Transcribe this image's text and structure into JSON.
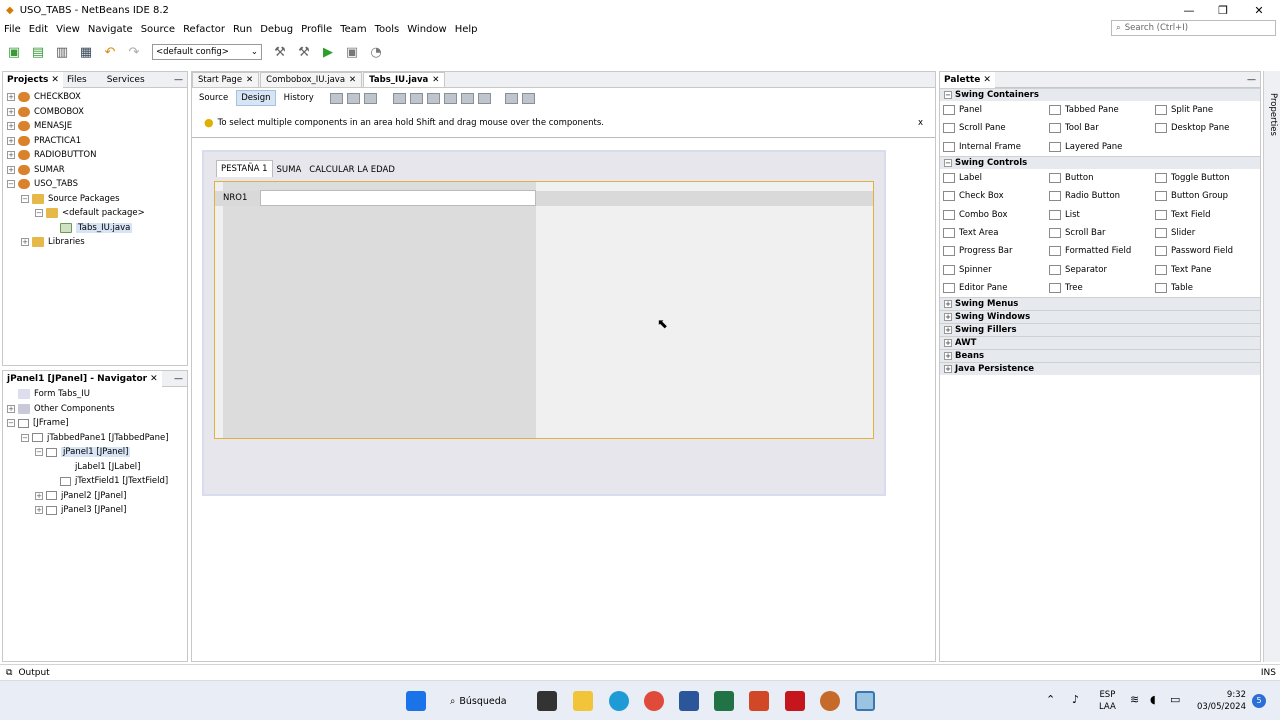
{
  "window": {
    "title": "USO_TABS - NetBeans IDE 8.2",
    "controls": [
      "—",
      "❐",
      "✕"
    ]
  },
  "menu": [
    "File",
    "Edit",
    "View",
    "Navigate",
    "Source",
    "Refactor",
    "Run",
    "Debug",
    "Profile",
    "Team",
    "Tools",
    "Window",
    "Help"
  ],
  "search": {
    "placeholder": "Search (Ctrl+I)"
  },
  "toolbar": {
    "config": "<default config>"
  },
  "projects": {
    "tabs": [
      "Projects",
      "Files",
      "Services"
    ],
    "tree": [
      {
        "label": "CHECKBOX",
        "indent": 0,
        "exp": "+",
        "type": "proj"
      },
      {
        "label": "COMBOBOX",
        "indent": 0,
        "exp": "+",
        "type": "proj"
      },
      {
        "label": "MENASJE",
        "indent": 0,
        "exp": "+",
        "type": "proj"
      },
      {
        "label": "PRACTICA1",
        "indent": 0,
        "exp": "+",
        "type": "proj"
      },
      {
        "label": "RADIOBUTTON",
        "indent": 0,
        "exp": "+",
        "type": "proj"
      },
      {
        "label": "SUMAR",
        "indent": 0,
        "exp": "+",
        "type": "proj"
      },
      {
        "label": "USO_TABS",
        "indent": 0,
        "exp": "−",
        "type": "proj"
      },
      {
        "label": "Source Packages",
        "indent": 1,
        "exp": "−",
        "type": "folder"
      },
      {
        "label": "<default package>",
        "indent": 2,
        "exp": "−",
        "type": "pkg"
      },
      {
        "label": "Tabs_IU.java",
        "indent": 3,
        "exp": "",
        "type": "file",
        "sel": true
      },
      {
        "label": "Libraries",
        "indent": 1,
        "exp": "+",
        "type": "folder"
      }
    ]
  },
  "navigator": {
    "title": "jPanel1 [JPanel] - Navigator",
    "tree": [
      {
        "label": "Form Tabs_IU",
        "indent": 0,
        "exp": "",
        "type": "form"
      },
      {
        "label": "Other Components",
        "indent": 0,
        "exp": "+",
        "type": "comp"
      },
      {
        "label": "[JFrame]",
        "indent": 0,
        "exp": "−",
        "type": "box"
      },
      {
        "label": "jTabbedPane1 [JTabbedPane]",
        "indent": 1,
        "exp": "−",
        "type": "box"
      },
      {
        "label": "jPanel1 [JPanel]",
        "indent": 2,
        "exp": "−",
        "type": "box",
        "sel": true
      },
      {
        "label": "jLabel1 [JLabel]",
        "indent": 3,
        "exp": "",
        "type": "label"
      },
      {
        "label": "jTextField1 [JTextField]",
        "indent": 3,
        "exp": "",
        "type": "box"
      },
      {
        "label": "jPanel2 [JPanel]",
        "indent": 2,
        "exp": "+",
        "type": "box"
      },
      {
        "label": "jPanel3 [JPanel]",
        "indent": 2,
        "exp": "+",
        "type": "box"
      }
    ]
  },
  "editor": {
    "tabs": [
      {
        "label": "Start Page",
        "active": false
      },
      {
        "label": "Combobox_IU.java",
        "active": false
      },
      {
        "label": "Tabs_IU.java",
        "active": true
      }
    ],
    "modes": [
      "Source",
      "Design",
      "History"
    ],
    "hint": "To select multiple components in an area hold Shift and drag mouse over the components.",
    "hint_close": "x",
    "form_tabs": [
      "PESTAÑA 1",
      "SUMA",
      "CALCULAR LA EDAD"
    ],
    "label_nro1": "NRO1"
  },
  "palette": {
    "title": "Palette",
    "sections": [
      {
        "name": "Swing Containers",
        "items": [
          "Panel",
          "Tabbed Pane",
          "Split Pane",
          "Scroll Pane",
          "Tool Bar",
          "Desktop Pane",
          "Internal Frame",
          "Layered Pane"
        ]
      },
      {
        "name": "Swing Controls",
        "items": [
          "Label",
          "Button",
          "Toggle Button",
          "Check Box",
          "Radio Button",
          "Button Group",
          "Combo Box",
          "List",
          "Text Field",
          "Text Area",
          "Scroll Bar",
          "Slider",
          "Progress Bar",
          "Formatted Field",
          "Password Field",
          "Spinner",
          "Separator",
          "Text Pane",
          "Editor Pane",
          "Tree",
          "Table"
        ]
      }
    ],
    "collapsed": [
      "Swing Menus",
      "Swing Windows",
      "Swing Fillers",
      "AWT",
      "Beans",
      "Java Persistence"
    ],
    "side_tab": "Properties"
  },
  "status": {
    "output": "Output",
    "mode": "INS"
  },
  "taskbar": {
    "search": "Búsqueda",
    "lang1": "ESP",
    "lang2": "LAA",
    "time": "9:32",
    "date": "03/05/2024",
    "badge": "5"
  }
}
